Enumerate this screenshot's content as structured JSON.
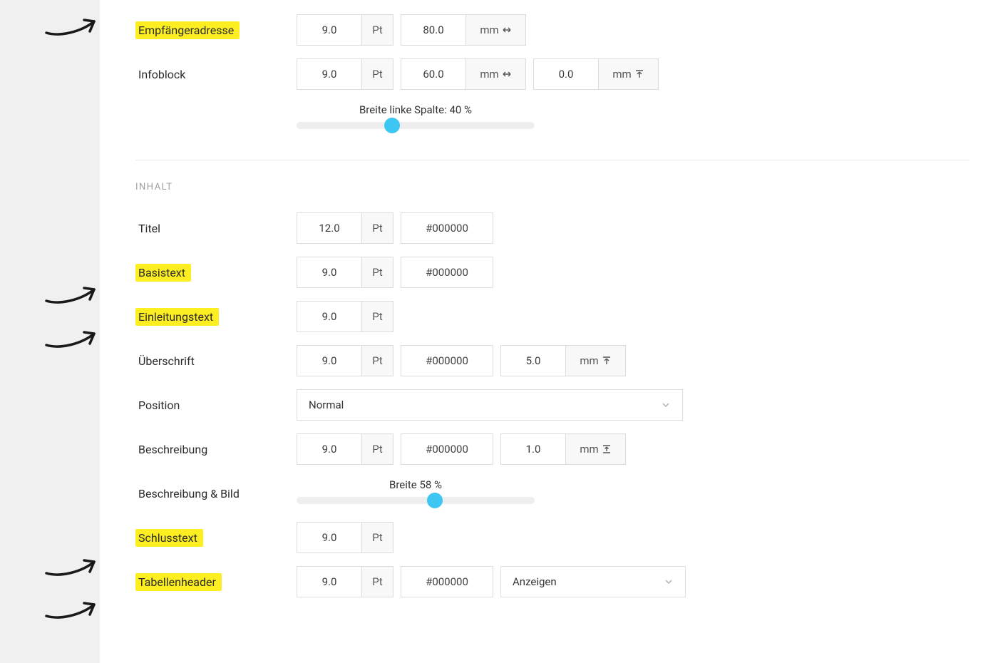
{
  "rows": {
    "empfaenger": {
      "label": "Empfängeradresse",
      "size": "9.0",
      "sizeUnit": "Pt",
      "width": "80.0",
      "widthUnit": "mm"
    },
    "infoblock": {
      "label": "Infoblock",
      "size": "9.0",
      "sizeUnit": "Pt",
      "width": "60.0",
      "widthUnit": "mm",
      "offset": "0.0",
      "offsetUnit": "mm"
    },
    "titel": {
      "label": "Titel",
      "size": "12.0",
      "sizeUnit": "Pt",
      "color": "#000000"
    },
    "basistext": {
      "label": "Basistext",
      "size": "9.0",
      "sizeUnit": "Pt",
      "color": "#000000"
    },
    "einleitung": {
      "label": "Einleitungstext",
      "size": "9.0",
      "sizeUnit": "Pt"
    },
    "ueberschrift": {
      "label": "Überschrift",
      "size": "9.0",
      "sizeUnit": "Pt",
      "color": "#000000",
      "margin": "5.0",
      "marginUnit": "mm"
    },
    "position": {
      "label": "Position",
      "value": "Normal"
    },
    "beschreibung": {
      "label": "Beschreibung",
      "size": "9.0",
      "sizeUnit": "Pt",
      "color": "#000000",
      "margin": "1.0",
      "marginUnit": "mm"
    },
    "beschreibung_bild": {
      "label": "Beschreibung & Bild"
    },
    "schlusstext": {
      "label": "Schlusstext",
      "size": "9.0",
      "sizeUnit": "Pt"
    },
    "tabellenheader": {
      "label": "Tabellenheader",
      "size": "9.0",
      "sizeUnit": "Pt",
      "color": "#000000",
      "select": "Anzeigen"
    }
  },
  "sliders": {
    "linkeSpalte": {
      "label": "Breite linke Spalte: 40 %",
      "percent": 40
    },
    "breite": {
      "label": "Breite 58 %",
      "percent": 58
    }
  },
  "section": {
    "inhalt": "INHALT"
  }
}
